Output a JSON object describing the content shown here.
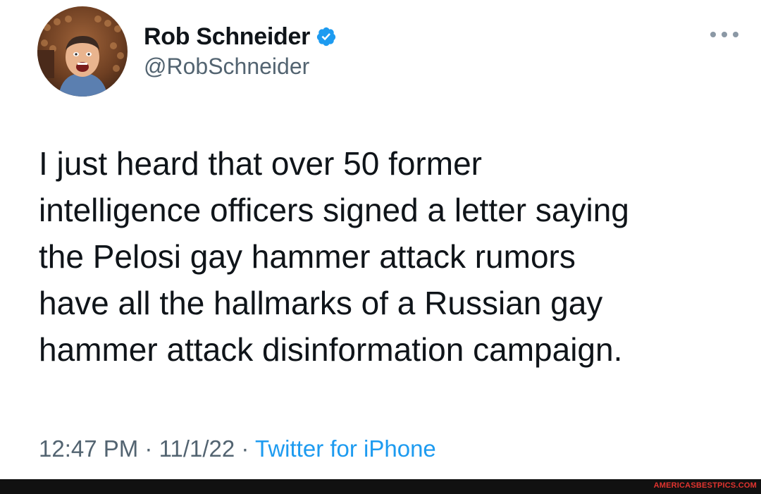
{
  "tweet": {
    "display_name": "Rob Schneider",
    "handle": "@RobSchneider",
    "verified": true,
    "text": "I just heard that over 50 former\nintelligence officers signed a letter saying\nthe  Pelosi gay hammer attack rumors\nhave all the hallmarks of a Russian gay\nhammer attack disinformation campaign.",
    "time": "12:47 PM",
    "date": "11/1/22",
    "separator": "·",
    "source": "Twitter for iPhone"
  },
  "icons": {
    "verified": "verified-badge-icon",
    "more": "more-options-icon"
  },
  "colors": {
    "text": "#0f1419",
    "secondary": "#536471",
    "link": "#1d9bf0",
    "verified": "#1d9bf0",
    "watermark": "#e3342f"
  },
  "watermark": "AMERICASBESTPICS.COM"
}
